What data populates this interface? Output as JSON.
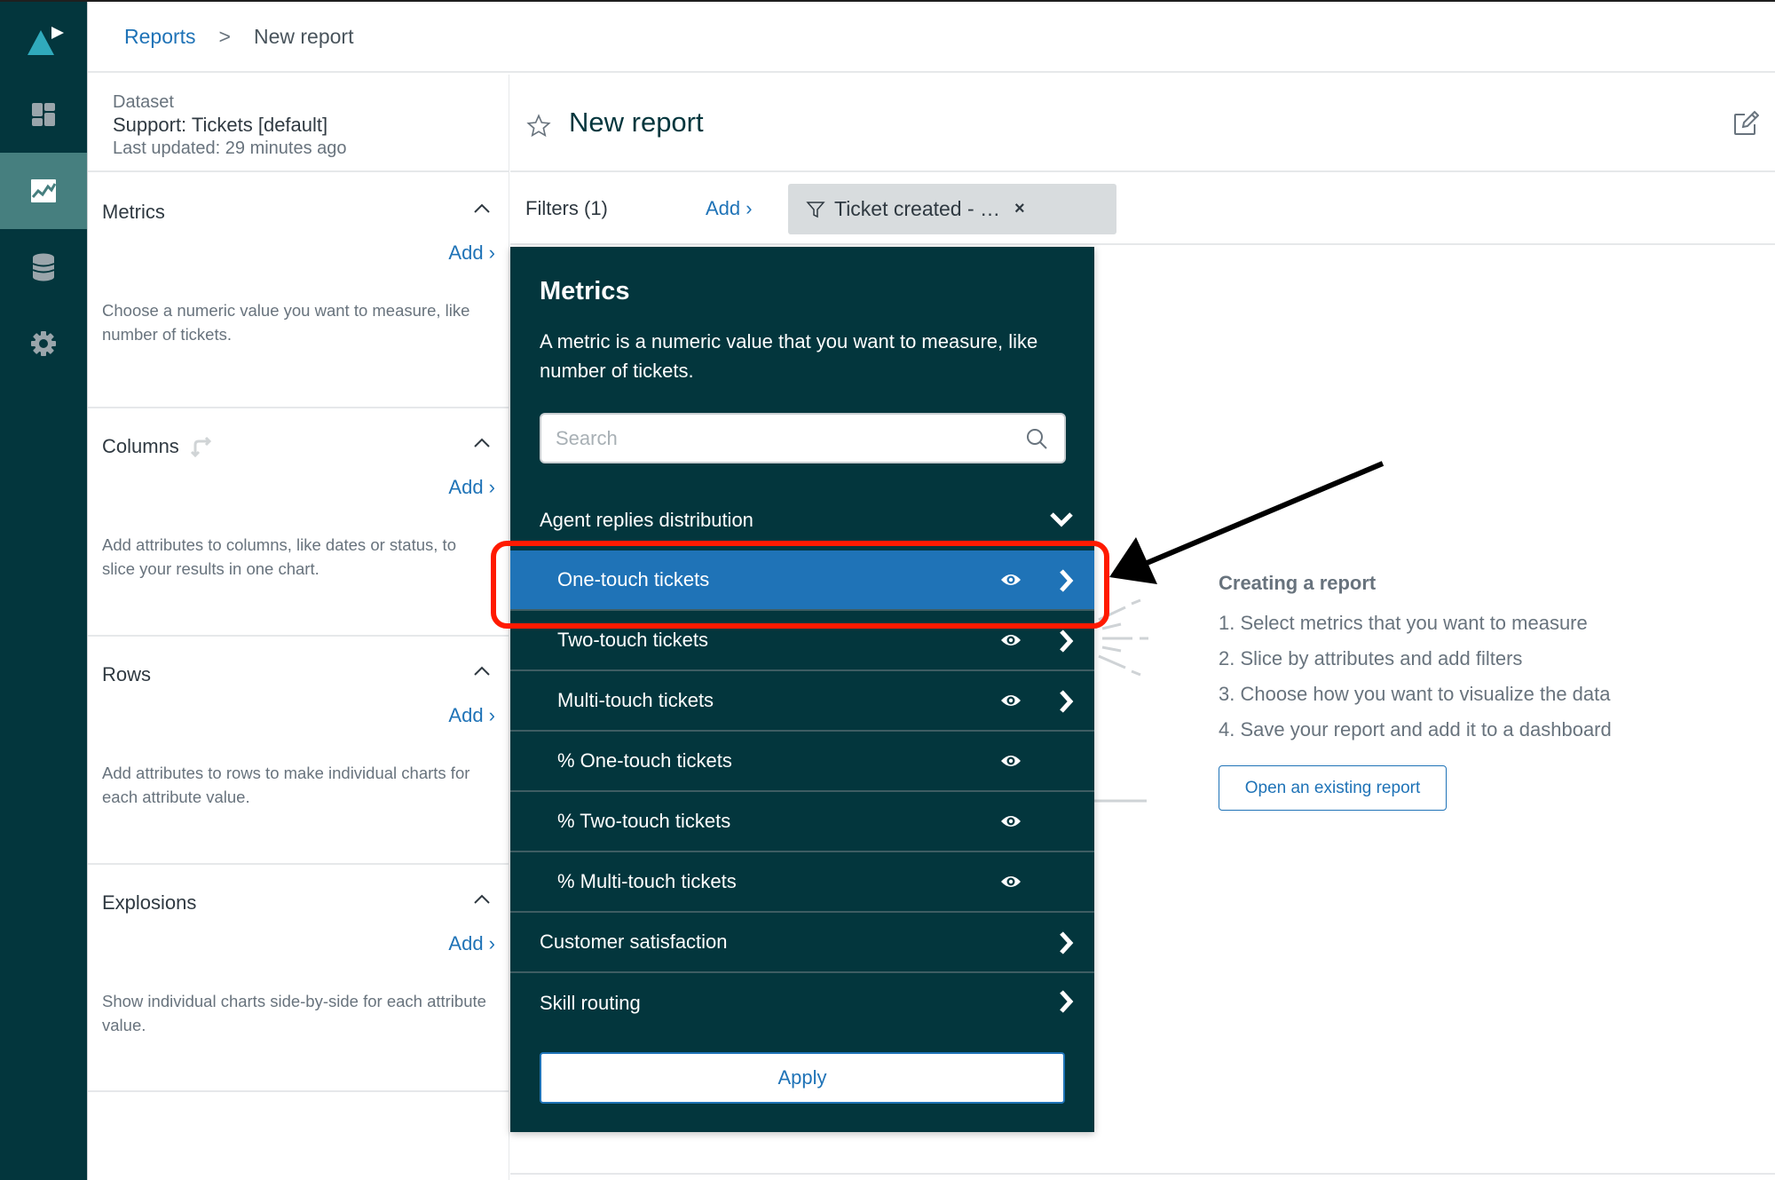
{
  "app": {
    "brand_color": "#03363d",
    "accent_color": "#1f73b7",
    "selected_row_color": "#1f73b7",
    "annotation_color": "#ff1a00"
  },
  "sidebar": {
    "logo_icon": "explore-logo-icon",
    "items": [
      {
        "name": "dashboards",
        "icon": "dashboard-grid-icon",
        "active": false
      },
      {
        "name": "reports",
        "icon": "line-chart-icon",
        "active": true
      },
      {
        "name": "datasets",
        "icon": "database-icon",
        "active": false
      },
      {
        "name": "settings",
        "icon": "gear-icon",
        "active": false
      }
    ]
  },
  "breadcrumb": {
    "parent": "Reports",
    "separator": ">",
    "current": "New report"
  },
  "dataset": {
    "label": "Dataset",
    "name": "Support: Tickets [default]",
    "last_updated": "Last updated: 29 minutes ago"
  },
  "config_sections": [
    {
      "title": "Metrics",
      "add_label": "Add ›",
      "description": "Choose a numeric value you want to measure, like number of tickets.",
      "has_swap_icon": false
    },
    {
      "title": "Columns",
      "add_label": "Add ›",
      "description": "Add attributes to columns, like dates or status, to slice your results in one chart.",
      "has_swap_icon": true
    },
    {
      "title": "Rows",
      "add_label": "Add ›",
      "description": "Add attributes to rows to make individual charts for each attribute value.",
      "has_swap_icon": false
    },
    {
      "title": "Explosions",
      "add_label": "Add ›",
      "description": "Show individual charts side-by-side for each attribute value.",
      "has_swap_icon": false
    }
  ],
  "report": {
    "title": "New report",
    "favorite": false
  },
  "filters": {
    "label": "Filters (1)",
    "add_label": "Add ›",
    "chips": [
      {
        "label": "Ticket created - …",
        "remove_icon": "×"
      }
    ]
  },
  "metrics_panel": {
    "title": "Metrics",
    "description": "A metric is a numeric value that you want to measure, like number of tickets.",
    "search_placeholder": "Search",
    "search_value": "",
    "groups": [
      {
        "label": "Agent replies distribution",
        "expanded": true,
        "items": [
          {
            "label": "One-touch tickets",
            "selected": true,
            "has_eye": true,
            "has_chevron": true
          },
          {
            "label": "Two-touch tickets",
            "selected": false,
            "has_eye": true,
            "has_chevron": true
          },
          {
            "label": "Multi-touch tickets",
            "selected": false,
            "has_eye": true,
            "has_chevron": true
          },
          {
            "label": "% One-touch tickets",
            "selected": false,
            "has_eye": true,
            "has_chevron": false
          },
          {
            "label": "% Two-touch tickets",
            "selected": false,
            "has_eye": true,
            "has_chevron": false
          },
          {
            "label": "% Multi-touch tickets",
            "selected": false,
            "has_eye": true,
            "has_chevron": false
          }
        ]
      },
      {
        "label": "Customer satisfaction",
        "expanded": false
      },
      {
        "label": "Skill routing",
        "expanded": false
      }
    ],
    "apply_label": "Apply"
  },
  "empty_state": {
    "title": "Creating a report",
    "steps": [
      "1. Select metrics that you want to measure",
      "2. Slice by attributes and add filters",
      "3. Choose how you want to visualize the data",
      "4. Save your report and add it to a dashboard"
    ],
    "open_button": "Open an existing report"
  }
}
